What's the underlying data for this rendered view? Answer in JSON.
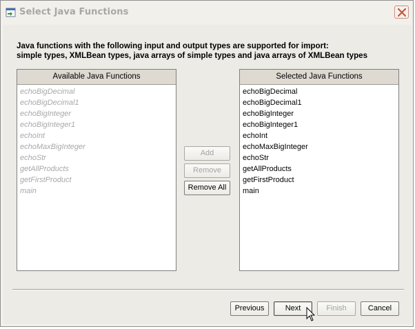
{
  "window": {
    "title": "Select Java Functions",
    "icon": "app-window-icon",
    "close_icon": "close-icon"
  },
  "description": {
    "line1": "Java functions with the following input and output types are supported for import:",
    "line2": "simple types, XMLBean types, java arrays of simple types and java arrays of XMLBean types"
  },
  "available": {
    "header": "Available Java Functions",
    "items": [
      {
        "label": "echoBigDecimal"
      },
      {
        "label": "echoBigDecimal1"
      },
      {
        "label": "echoBigInteger"
      },
      {
        "label": "echoBigInteger1"
      },
      {
        "label": "echoInt"
      },
      {
        "label": "echoMaxBigInteger"
      },
      {
        "label": "echoStr"
      },
      {
        "label": "getAllProducts"
      },
      {
        "label": "getFirstProduct"
      },
      {
        "label": "main"
      }
    ]
  },
  "selected": {
    "header": "Selected Java Functions",
    "items": [
      {
        "label": "echoBigDecimal"
      },
      {
        "label": "echoBigDecimal1"
      },
      {
        "label": "echoBigInteger"
      },
      {
        "label": "echoBigInteger1"
      },
      {
        "label": "echoInt"
      },
      {
        "label": "echoMaxBigInteger"
      },
      {
        "label": "echoStr"
      },
      {
        "label": "getAllProducts"
      },
      {
        "label": "getFirstProduct"
      },
      {
        "label": "main"
      }
    ]
  },
  "transfer_buttons": {
    "add": "Add",
    "remove": "Remove",
    "remove_all": "Remove All"
  },
  "footer_buttons": {
    "previous": "Previous",
    "next": "Next",
    "finish": "Finish",
    "cancel": "Cancel"
  },
  "colors": {
    "dialog_bg": "#ecebe6",
    "header_bg": "#dedad2",
    "disabled_text": "#a8a8a8",
    "close_accent": "#c7553c"
  }
}
